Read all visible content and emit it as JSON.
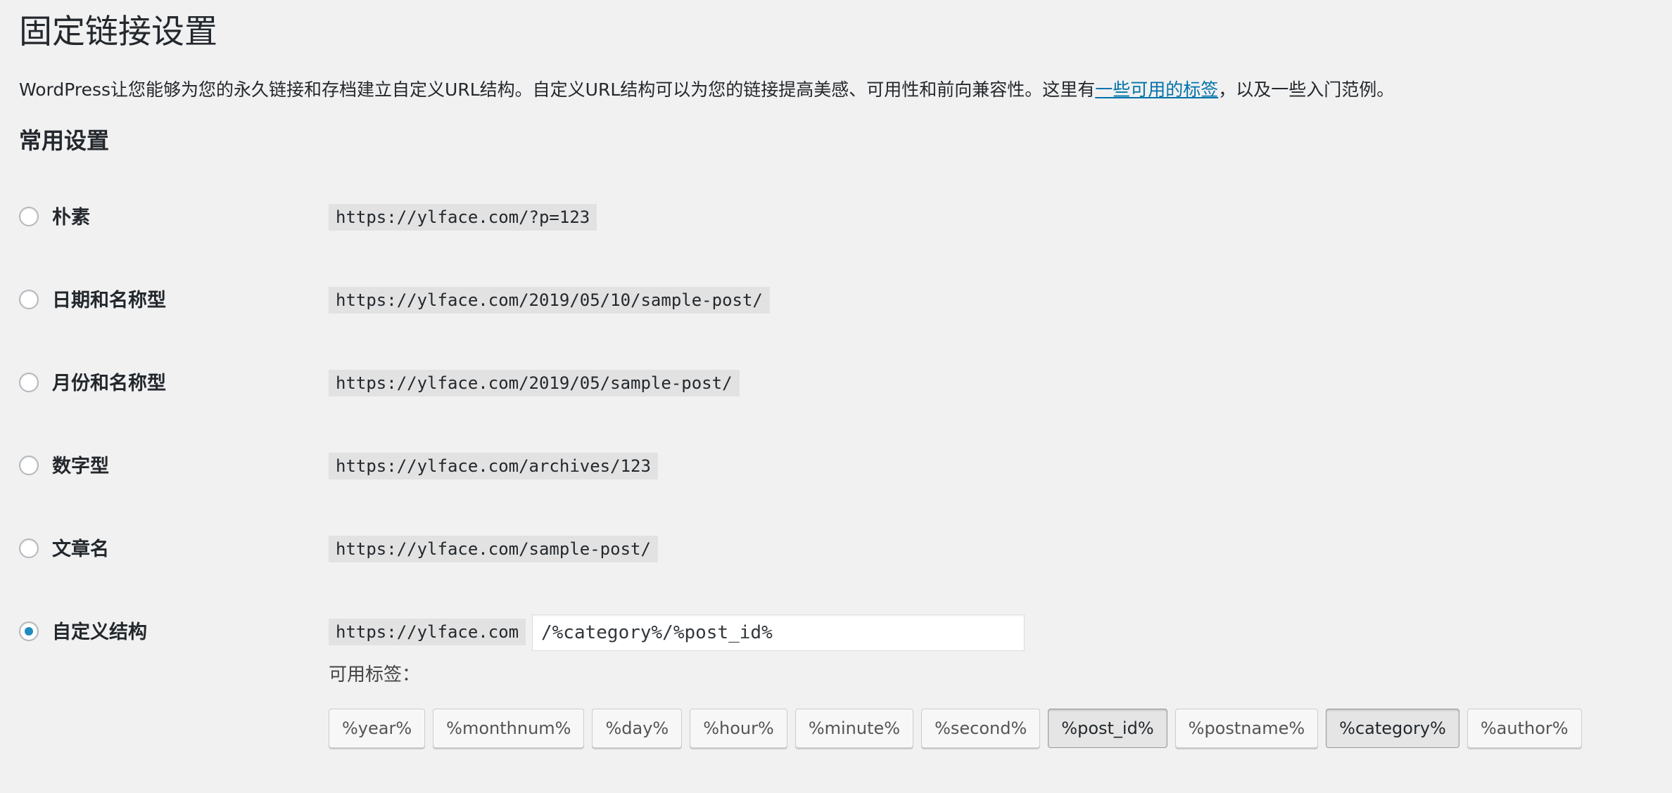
{
  "page": {
    "title": "固定链接设置",
    "intro_before": "WordPress让您能够为您的永久链接和存档建立自定义URL结构。自定义URL结构可以为您的链接提高美感、可用性和前向兼容性。这里有",
    "intro_link": "一些可用的标签",
    "intro_after": "，以及一些入门范例。"
  },
  "common_settings": {
    "title": "常用设置",
    "options": [
      {
        "label": "朴素",
        "example": "https://ylface.com/?p=123",
        "checked": false
      },
      {
        "label": "日期和名称型",
        "example": "https://ylface.com/2019/05/10/sample-post/",
        "checked": false
      },
      {
        "label": "月份和名称型",
        "example": "https://ylface.com/2019/05/sample-post/",
        "checked": false
      },
      {
        "label": "数字型",
        "example": "https://ylface.com/archives/123",
        "checked": false
      },
      {
        "label": "文章名",
        "example": "https://ylface.com/sample-post/",
        "checked": false
      },
      {
        "label": "自定义结构",
        "prefix": "https://ylface.com",
        "checked": true
      }
    ]
  },
  "custom_structure": {
    "value": "/%category%/%post_id%",
    "available_tags_label": "可用标签：",
    "tags": [
      {
        "label": "%year%",
        "active": false
      },
      {
        "label": "%monthnum%",
        "active": false
      },
      {
        "label": "%day%",
        "active": false
      },
      {
        "label": "%hour%",
        "active": false
      },
      {
        "label": "%minute%",
        "active": false
      },
      {
        "label": "%second%",
        "active": false
      },
      {
        "label": "%post_id%",
        "active": true
      },
      {
        "label": "%postname%",
        "active": false
      },
      {
        "label": "%category%",
        "active": true
      },
      {
        "label": "%author%",
        "active": false
      }
    ]
  },
  "colors": {
    "background": "#f1f1f1",
    "link": "#0073aa",
    "radio_checked": "#1e8cbe",
    "code_background": "#e2e2e2"
  }
}
